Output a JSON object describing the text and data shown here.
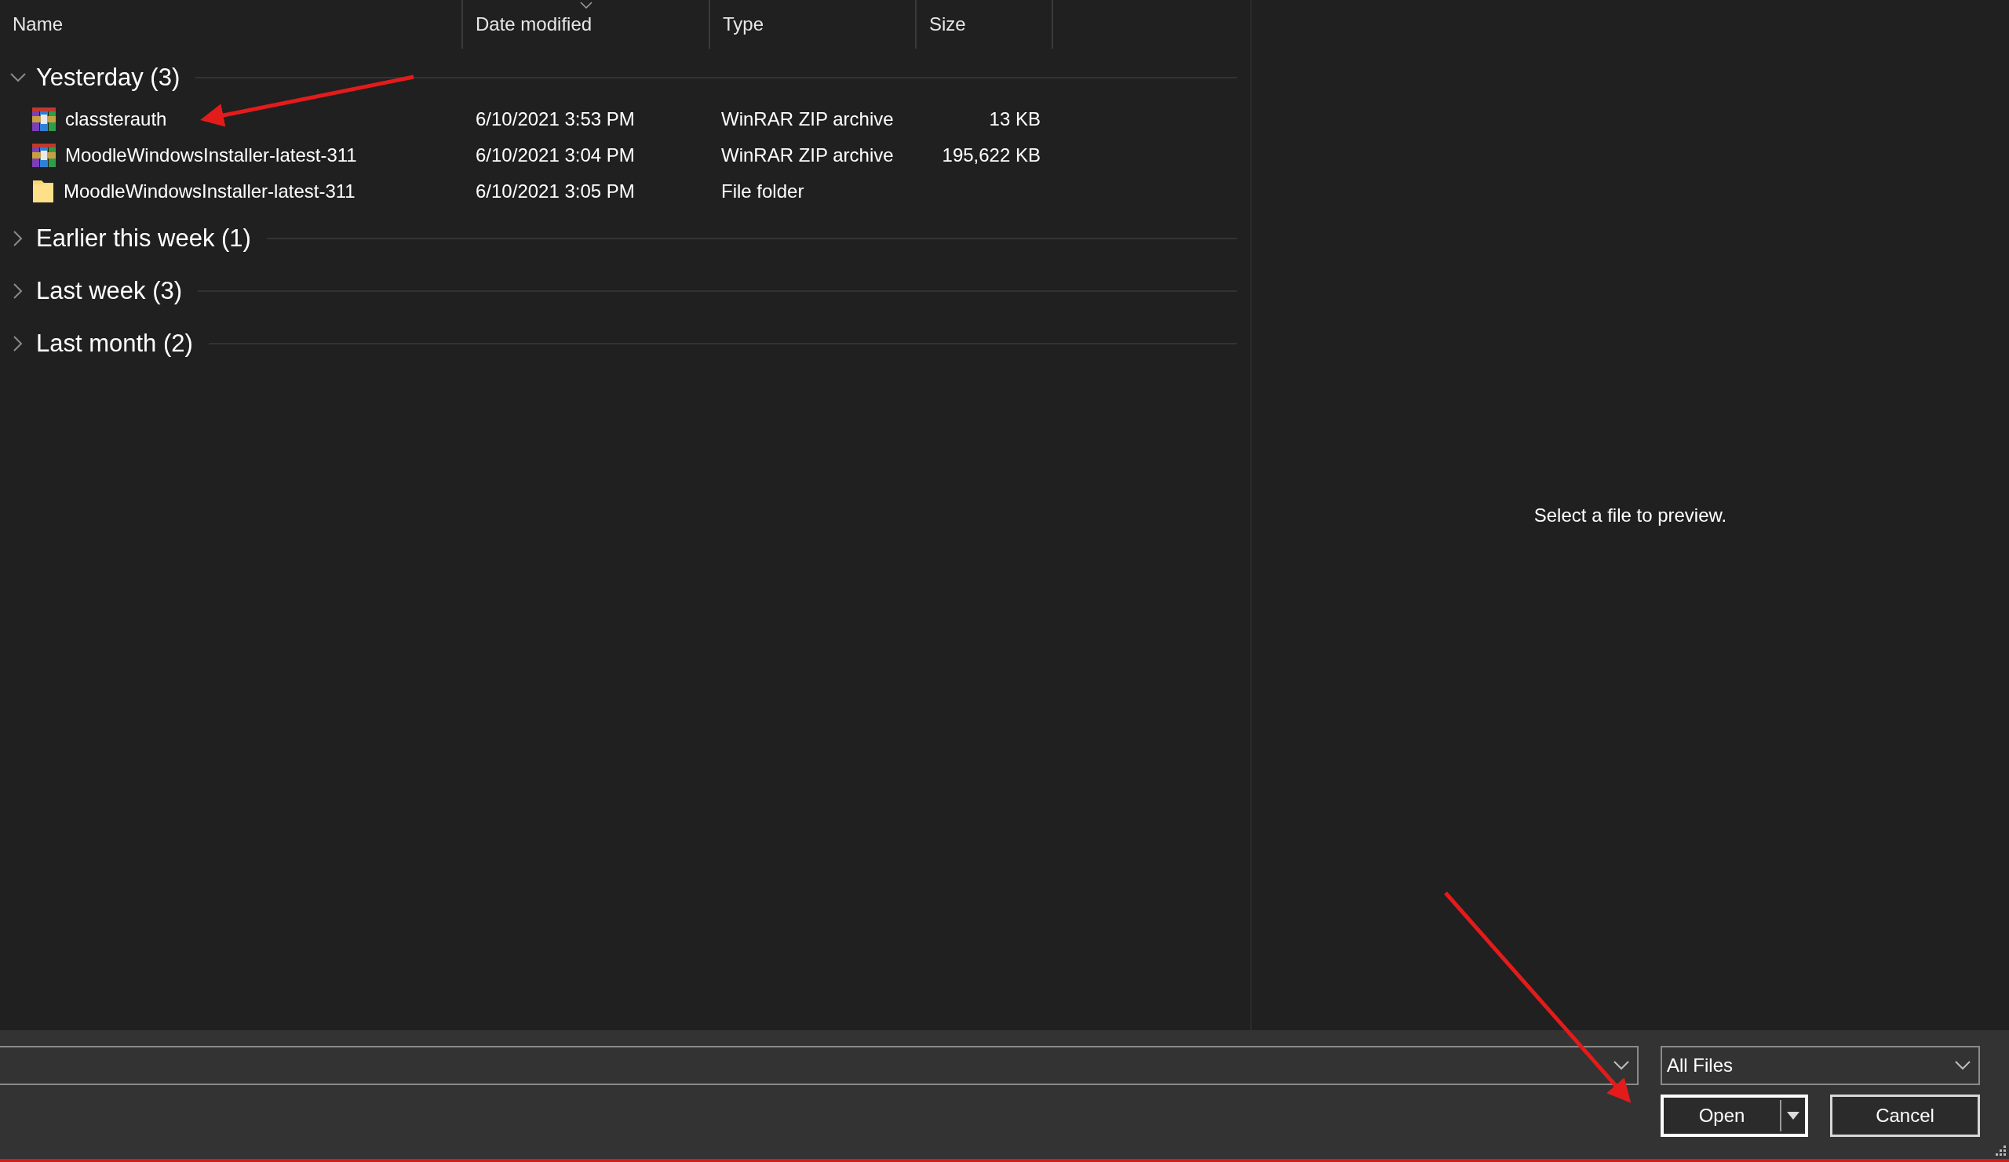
{
  "columns": [
    {
      "label": "Name",
      "sorted": false
    },
    {
      "label": "Date modified",
      "sorted": true
    },
    {
      "label": "Type",
      "sorted": false
    },
    {
      "label": "Size",
      "sorted": false
    }
  ],
  "groups": [
    {
      "label": "Yesterday (3)",
      "expanded": true,
      "files": [
        {
          "kind": "archive",
          "name": "classterauth",
          "date": "6/10/2021 3:53 PM",
          "type": "WinRAR ZIP archive",
          "size": "13 KB"
        },
        {
          "kind": "archive",
          "name": "MoodleWindowsInstaller-latest-311",
          "date": "6/10/2021 3:04 PM",
          "type": "WinRAR ZIP archive",
          "size": "195,622 KB"
        },
        {
          "kind": "folder",
          "name": "MoodleWindowsInstaller-latest-311",
          "date": "6/10/2021 3:05 PM",
          "type": "File folder"
        }
      ]
    },
    {
      "label": "Earlier this week (1)",
      "expanded": false
    },
    {
      "label": "Last week (3)",
      "expanded": false
    },
    {
      "label": "Last month (2)",
      "expanded": false
    }
  ],
  "preview": {
    "message": "Select a file to preview."
  },
  "footer": {
    "file_type": "All Files",
    "buttons": [
      {
        "label": "Open",
        "kind": "split"
      },
      {
        "label": "Cancel",
        "kind": "plain"
      }
    ]
  }
}
